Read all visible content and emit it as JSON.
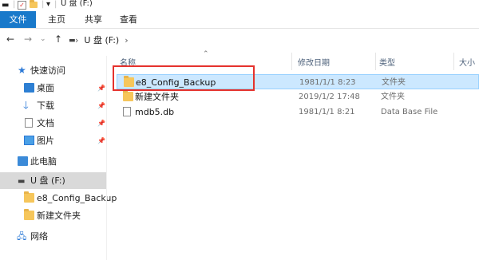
{
  "ribbon": {
    "tabs": [
      "文件",
      "主页",
      "共享",
      "查看"
    ]
  },
  "address": {
    "path": "U 盘 (F:)"
  },
  "sidebar": {
    "quick_access": "快速访问",
    "pinned": [
      "桌面",
      "下载",
      "文档",
      "图片"
    ],
    "this_pc": "此电脑",
    "drive": "U 盘 (F:)",
    "drive_children": [
      "e8_Config_Backup",
      "新建文件夹"
    ],
    "network": "网络"
  },
  "columns": {
    "name": "名称",
    "date": "修改日期",
    "type": "类型",
    "size": "大小"
  },
  "files": [
    {
      "name": "e8_Config_Backup",
      "date": "1981/1/1 8:23",
      "type": "文件夹",
      "icon": "folder-icon"
    },
    {
      "name": "新建文件夹",
      "date": "2019/1/2 17:48",
      "type": "文件夹",
      "icon": "folder-icon"
    },
    {
      "name": "mdb5.db",
      "date": "1981/1/1 8:21",
      "type": "Data Base File",
      "icon": "document-icon"
    }
  ],
  "colors": {
    "accent": "#1979ca",
    "selection": "#cce8ff",
    "highlight_box": "#e5322d",
    "folder": "#f6c65b"
  }
}
